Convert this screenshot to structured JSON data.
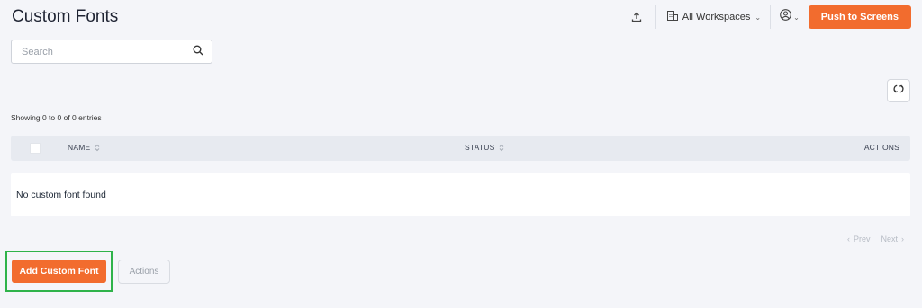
{
  "header": {
    "title": "Custom Fonts",
    "upload_icon": "upload-icon",
    "workspace_label": "All Workspaces",
    "workspace_icon": "building-icon",
    "user_icon": "user-circle-icon",
    "push_label": "Push to Screens"
  },
  "search": {
    "placeholder": "Search",
    "icon": "search-icon"
  },
  "toolbar": {
    "refresh_icon": "refresh-icon"
  },
  "table": {
    "entries_info": "Showing 0 to 0 of 0 entries",
    "columns": {
      "name": "NAME",
      "status": "STATUS",
      "actions": "ACTIONS"
    },
    "empty_message": "No custom font found"
  },
  "pagination": {
    "prev": "Prev",
    "next": "Next"
  },
  "footer": {
    "add_label": "Add Custom Font",
    "actions_label": "Actions"
  },
  "colors": {
    "accent": "#f26c2e",
    "background": "#f4f5f9",
    "table_header": "#e7eaf0",
    "highlight": "#2fb34a"
  }
}
